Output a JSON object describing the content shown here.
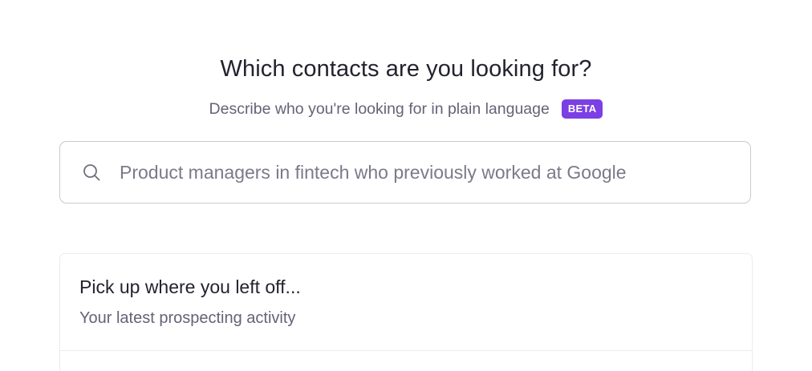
{
  "header": {
    "title": "Which contacts are you looking for?",
    "subtitle": "Describe who you're looking for in plain language",
    "badge": "BETA"
  },
  "search": {
    "icon": "search-icon",
    "placeholder": "Product managers in fintech who previously worked at Google",
    "value": ""
  },
  "recent": {
    "title": "Pick up where you left off...",
    "subtitle": "Your latest prospecting activity"
  },
  "colors": {
    "accent": "#7b3fe4",
    "heading": "#23232f",
    "muted": "#636377",
    "border": "#c9c9d3"
  }
}
